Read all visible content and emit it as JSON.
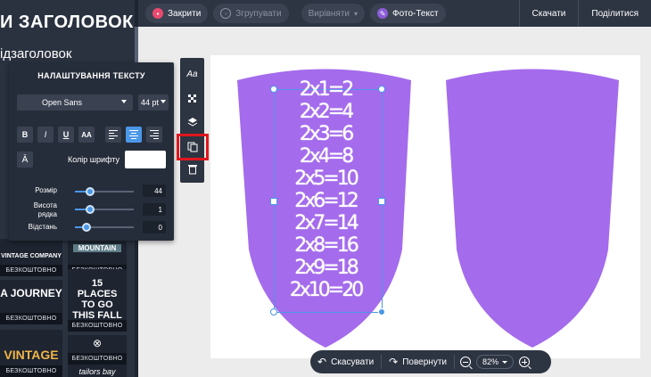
{
  "topbar": {
    "close_label": "Закрити",
    "group_label": "Згрупувати",
    "align_label": "Вирівняти",
    "photo_text_label": "Фото-Текст",
    "download_label": "Скачати",
    "share_label": "Поділитися"
  },
  "left_panel": {
    "heading": "И ЗАГОЛОВОК",
    "subheading": "ідзаголовок",
    "free_label": "БЕЗКОШТОВНО",
    "tiles": [
      {
        "text": "MOUNTAIN"
      },
      {
        "text": "VINTAGE COMPANY"
      },
      {
        "text": "A JOURNEY"
      },
      {
        "text": "15 PLACES TO GO THIS FALL"
      },
      {
        "text": "VINTAGE"
      },
      {
        "text": "tailors bay"
      }
    ]
  },
  "settings": {
    "title": "НАЛАШТУВАННЯ ТЕКСТУ",
    "font": "Open Sans",
    "size": "44 pt",
    "bold": "B",
    "italic": "I",
    "underline": "U",
    "caps": "AA",
    "color_label": "Колір шрифту",
    "text_color": "#ffffff",
    "sliders": [
      {
        "label": "Розмір",
        "value": "44",
        "pos": 0.25
      },
      {
        "label": "Висота рядка",
        "value": "1",
        "pos": 0.25
      },
      {
        "label": "Відстань",
        "value": "0",
        "pos": 0.2
      }
    ]
  },
  "vtool": {
    "font_label": "Aa"
  },
  "canvas": {
    "shield_color": "#a46bec",
    "lines": [
      "2x1=2",
      "2x2=4",
      "2x3=6",
      "2x4=8",
      "2x5=10",
      "2x6=12",
      "2x7=14",
      "2x8=16",
      "2x9=18",
      "2x10=20"
    ]
  },
  "bottombar": {
    "undo_label": "Скасувати",
    "redo_label": "Повернути",
    "zoom": "82%"
  },
  "colors": {
    "accent": "#4b97e8",
    "highlight": "#e0161d",
    "dark": "#2d3442"
  }
}
